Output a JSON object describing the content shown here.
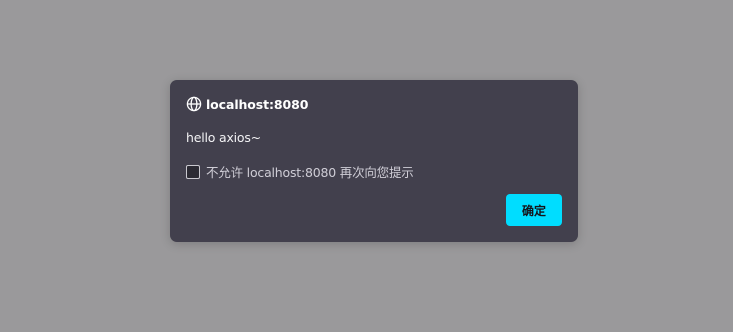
{
  "dialog": {
    "origin": "localhost:8080",
    "origin_icon": "globe-icon",
    "message": "hello axios~",
    "suppress_checkbox": {
      "label": "不允许 localhost:8080 再次向您提示",
      "checked": false
    },
    "ok_button_label": "确定"
  },
  "colors": {
    "backdrop": "#9a999b",
    "dialog_background": "#42404d",
    "accent": "#00ddff"
  }
}
